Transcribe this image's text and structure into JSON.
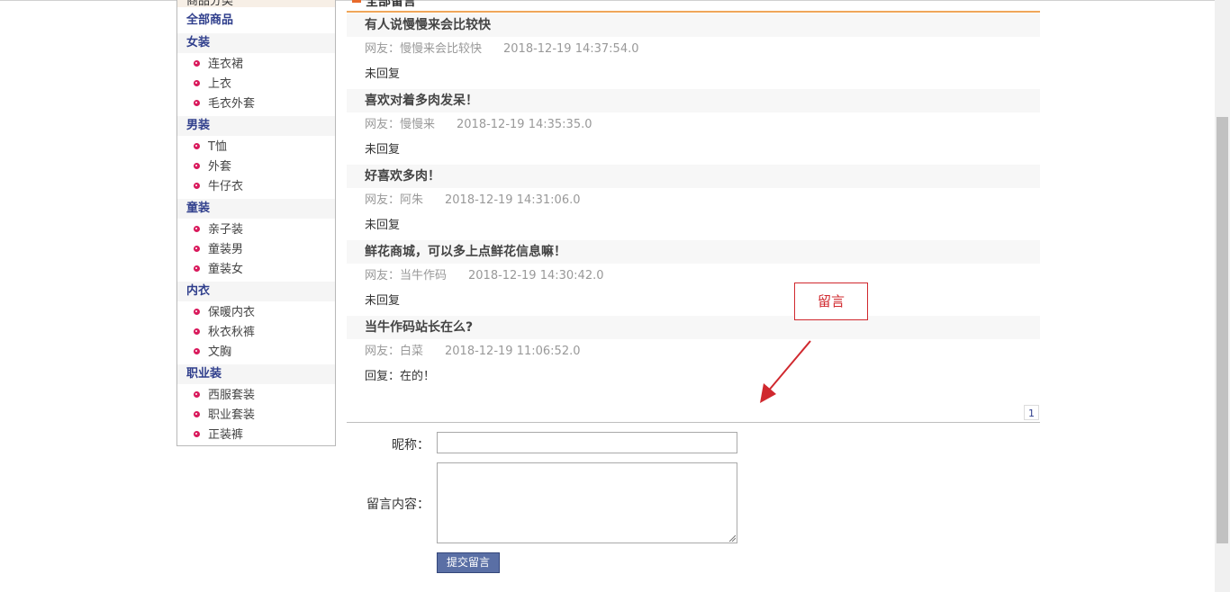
{
  "sidebar": {
    "title": "商品分类",
    "all": "全部商品",
    "categories": [
      {
        "name": "女装",
        "items": [
          "连衣裙",
          "上衣",
          "毛衣外套"
        ]
      },
      {
        "name": "男装",
        "items": [
          "T恤",
          "外套",
          "牛仔衣"
        ]
      },
      {
        "name": "童装",
        "items": [
          "亲子装",
          "童装男",
          "童装女"
        ]
      },
      {
        "name": "内衣",
        "items": [
          "保暖内衣",
          "秋衣秋裤",
          "文胸"
        ]
      },
      {
        "name": "职业装",
        "items": [
          "西服套装",
          "职业套装",
          "正装裤"
        ]
      }
    ]
  },
  "main": {
    "heading": "全部留言",
    "messages": [
      {
        "title": "有人说慢慢来会比较快",
        "author": "网友：慢慢来会比较快",
        "time": "2018-12-19 14:37:54.0",
        "reply": "未回复"
      },
      {
        "title": "喜欢对着多肉发呆！",
        "author": "网友：慢慢来",
        "time": "2018-12-19 14:35:35.0",
        "reply": "未回复"
      },
      {
        "title": "好喜欢多肉！",
        "author": "网友：阿朱",
        "time": "2018-12-19 14:31:06.0",
        "reply": "未回复"
      },
      {
        "title": "鲜花商城，可以多上点鲜花信息嘛！",
        "author": "网友：当牛作码",
        "time": "2018-12-19 14:30:42.0",
        "reply": "未回复"
      },
      {
        "title": "当牛作码站长在么?",
        "author": "网友：白菜",
        "time": "2018-12-19 11:06:52.0",
        "reply": "回复：在的！"
      }
    ],
    "pagination": {
      "current": "1"
    }
  },
  "form": {
    "nickname_label": "昵称：",
    "nickname_value": "",
    "content_label": "留言内容：",
    "content_value": "",
    "submit_label": "提交留言"
  },
  "annotation": {
    "label": "留言",
    "color": "#d0282e"
  },
  "colors": {
    "accent_orange": "#f0a65a",
    "link_blue": "#2f3e8c",
    "bullet_pink": "#d91a5c",
    "button_blue": "#5a6fa5"
  }
}
